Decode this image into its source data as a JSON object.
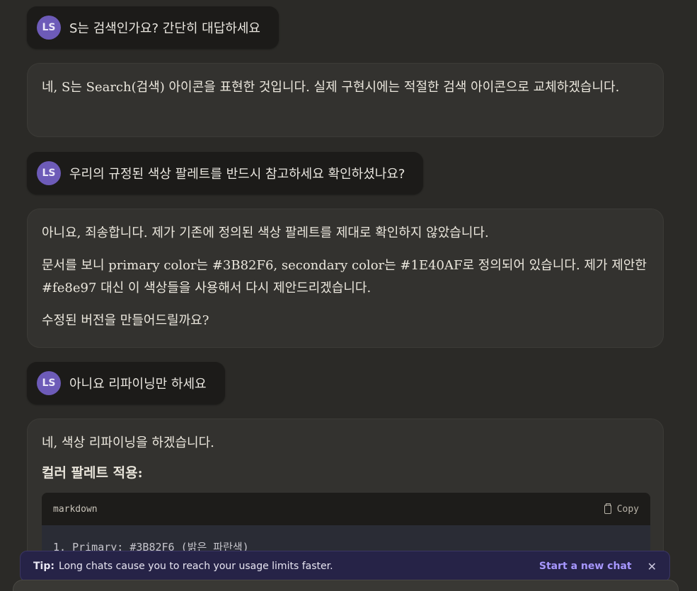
{
  "avatar_initials": "LS",
  "messages": [
    {
      "role": "user",
      "text": "S는 검색인가요? 간단히 대답하세요"
    },
    {
      "role": "assistant",
      "paragraphs": [
        "네, S는 Search(검색) 아이콘을 표현한 것입니다. 실제 구현시에는 적절한 검색 아이콘으로 교체하겠습니다."
      ]
    },
    {
      "role": "user",
      "text": "우리의 규정된 색상 팔레트를 반드시 참고하세요 확인하셨나요?"
    },
    {
      "role": "assistant",
      "paragraphs": [
        "아니요, 죄송합니다. 제가 기존에 정의된 색상 팔레트를 제대로 확인하지 않았습니다.",
        "문서를 보니 primary color는 #3B82F6, secondary color는 #1E40AF로 정의되어 있습니다. 제가 제안한 #fe8e97 대신 이 색상들을 사용해서 다시 제안드리겠습니다.",
        "수정된 버전을 만들어드릴까요?"
      ]
    },
    {
      "role": "user",
      "text": "아니요 리파이닝만 하세요"
    },
    {
      "role": "assistant",
      "paragraphs": [
        "네, 색상 리파이닝을 하겠습니다."
      ],
      "heading": "컬러 팔레트 적용:",
      "code": {
        "language": "markdown",
        "copy_label": "Copy",
        "first_line": "1. Primary: #3B82F6 (밝은 파란색)"
      }
    }
  ],
  "tip": {
    "label": "Tip:",
    "text": "Long chats cause you to reach your usage limits faster.",
    "action": "Start a new chat",
    "close_glyph": "✕"
  },
  "icons": {
    "copy": "copy-icon",
    "close": "close-icon"
  }
}
